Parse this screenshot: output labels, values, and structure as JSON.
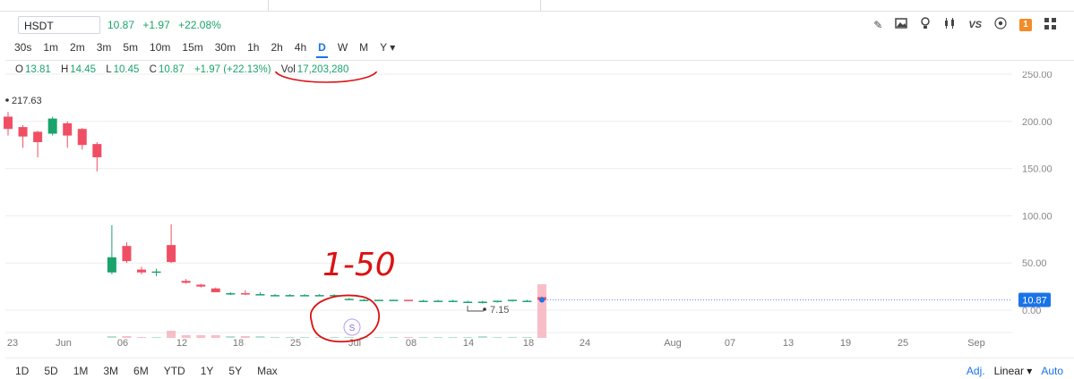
{
  "symbol": "HSDT",
  "quote": {
    "price": "10.87",
    "change": "+1.97",
    "change_pct": "+22.08%"
  },
  "toolbar": {
    "icons": [
      "pencil-icon",
      "image-icon",
      "lightbulb-icon",
      "candles-icon",
      "vs-icon",
      "settings-circle-icon",
      "notification-badge-icon",
      "grid-icon"
    ],
    "vs_label": "VS",
    "badge_count": "1"
  },
  "intervals": [
    "30s",
    "1m",
    "2m",
    "3m",
    "5m",
    "10m",
    "15m",
    "30m",
    "1h",
    "2h",
    "4h",
    "D",
    "W",
    "M",
    "Y ▾"
  ],
  "active_interval": "D",
  "ohlc": {
    "o_label": "O",
    "o": "13.81",
    "h_label": "H",
    "h": "14.45",
    "l_label": "L",
    "l": "10.45",
    "c_label": "C",
    "c": "10.87",
    "chg": "+1.97 (+22.13%)",
    "vol_label": "Vol",
    "vol": "17,203,280"
  },
  "ranges": [
    "1D",
    "5D",
    "1M",
    "3M",
    "6M",
    "YTD",
    "1Y",
    "5Y",
    "Max"
  ],
  "footer": {
    "adj": "Adj.",
    "scale": "Linear ▾",
    "auto": "Auto"
  },
  "annotations": {
    "handwritten": "1-50",
    "event_marker": "S"
  },
  "colors": {
    "up": "#1aa36b",
    "down": "#f04e64",
    "accent": "#1a73e8"
  },
  "chart_data": {
    "type": "candlestick",
    "y_ticks": [
      "250.00",
      "200.00",
      "150.00",
      "100.00",
      "50.00",
      "0.00"
    ],
    "ylim": [
      0,
      250
    ],
    "x_labels": [
      "23",
      "Jun",
      "06",
      "12",
      "18",
      "25",
      "Jul",
      "08",
      "14",
      "18",
      "24",
      "Aug",
      "07",
      "13",
      "19",
      "25",
      "Sep"
    ],
    "high_marker": "217.63",
    "low_marker": "7.15",
    "last_price": "10.87",
    "candles": [
      {
        "o": 205,
        "h": 210,
        "l": 185,
        "c": 192
      },
      {
        "o": 194,
        "h": 196,
        "l": 172,
        "c": 184
      },
      {
        "o": 189,
        "h": 190,
        "l": 162,
        "c": 178
      },
      {
        "o": 187,
        "h": 205,
        "l": 185,
        "c": 203
      },
      {
        "o": 198,
        "h": 200,
        "l": 172,
        "c": 185
      },
      {
        "o": 192,
        "h": 193,
        "l": 170,
        "c": 175
      },
      {
        "o": 176,
        "h": 178,
        "l": 147,
        "c": 162
      },
      {
        "o": 40,
        "h": 90,
        "l": 38,
        "c": 56
      },
      {
        "o": 68,
        "h": 72,
        "l": 50,
        "c": 52
      },
      {
        "o": 43,
        "h": 46,
        "l": 38,
        "c": 40
      },
      {
        "o": 40,
        "h": 44,
        "l": 36,
        "c": 41
      },
      {
        "o": 69,
        "h": 91,
        "l": 50,
        "c": 51
      },
      {
        "o": 31,
        "h": 33,
        "l": 28,
        "c": 29
      },
      {
        "o": 27,
        "h": 28,
        "l": 24,
        "c": 25
      },
      {
        "o": 23,
        "h": 24,
        "l": 19,
        "c": 19
      },
      {
        "o": 17,
        "h": 19,
        "l": 16,
        "c": 18
      },
      {
        "o": 18,
        "h": 21,
        "l": 16,
        "c": 17
      },
      {
        "o": 17,
        "h": 19,
        "l": 16,
        "c": 17
      },
      {
        "o": 16,
        "h": 17,
        "l": 15,
        "c": 16
      },
      {
        "o": 16,
        "h": 17,
        "l": 15,
        "c": 16
      },
      {
        "o": 16,
        "h": 17,
        "l": 15,
        "c": 16
      },
      {
        "o": 16,
        "h": 17,
        "l": 15,
        "c": 16
      },
      {
        "o": 16,
        "h": 17,
        "l": 15,
        "c": 16
      },
      {
        "o": 12,
        "h": 13,
        "l": 11,
        "c": 12
      },
      {
        "o": 11,
        "h": 12,
        "l": 10,
        "c": 11
      },
      {
        "o": 10,
        "h": 11,
        "l": 10,
        "c": 11
      },
      {
        "o": 11,
        "h": 11,
        "l": 10,
        "c": 11
      },
      {
        "o": 11,
        "h": 11,
        "l": 10,
        "c": 10
      },
      {
        "o": 10,
        "h": 11,
        "l": 10,
        "c": 10
      },
      {
        "o": 10,
        "h": 11,
        "l": 9,
        "c": 10
      },
      {
        "o": 10,
        "h": 11,
        "l": 9,
        "c": 10
      },
      {
        "o": 9,
        "h": 10,
        "l": 8,
        "c": 9
      },
      {
        "o": 9,
        "h": 10,
        "l": 7,
        "c": 9
      },
      {
        "o": 9,
        "h": 10,
        "l": 8,
        "c": 10
      },
      {
        "o": 10,
        "h": 11,
        "l": 9,
        "c": 11
      },
      {
        "o": 10,
        "h": 11,
        "l": 9,
        "c": 10
      },
      {
        "o": 13.81,
        "h": 14.45,
        "l": 10.45,
        "c": 10.87
      }
    ]
  }
}
